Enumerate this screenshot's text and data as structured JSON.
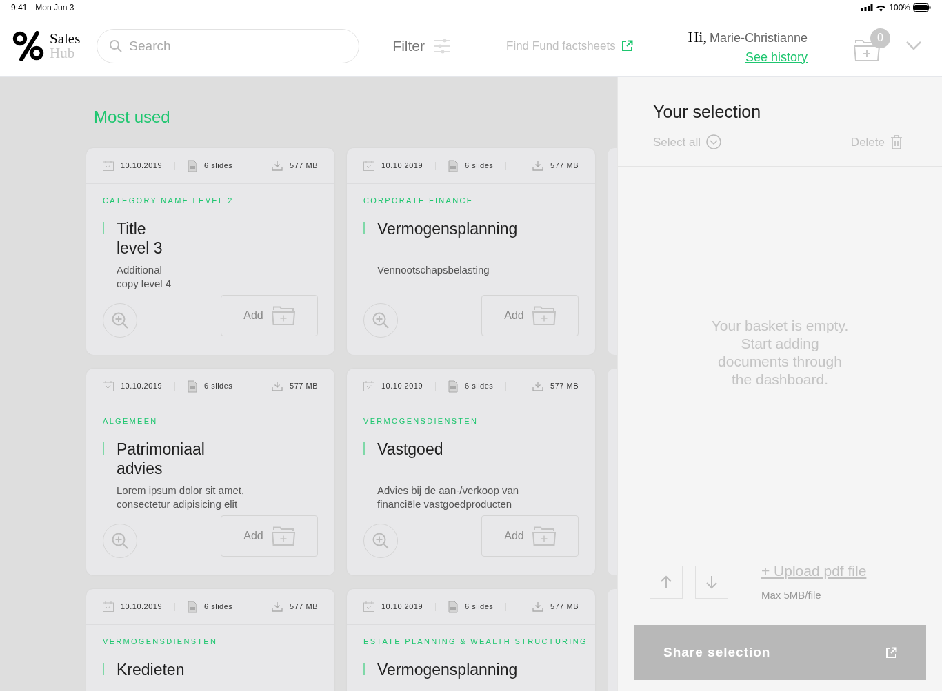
{
  "status_bar": {
    "time": "9:41",
    "date": "Mon Jun 3",
    "battery": "100%"
  },
  "header": {
    "logo_top": "Sales",
    "logo_bottom": "Hub",
    "search": {
      "placeholder": "Search"
    },
    "filter": "Filter",
    "factsheets_link": "Find Fund factsheets",
    "greeting": "Hi,",
    "user_name": "Marie-Christianne",
    "history_link": "See history",
    "basket_count": "0"
  },
  "section_title": "Most used",
  "cards": [
    {
      "date": "10.10.2019",
      "slides": "6 slides",
      "size": "577 MB",
      "category": "CATEGORY NAME LEVEL 2",
      "title": "Title\nlevel 3",
      "description": "Additional\ncopy level 4",
      "add_label": "Add"
    },
    {
      "date": "10.10.2019",
      "slides": "6 slides",
      "size": "577 MB",
      "category": "CORPORATE FINANCE",
      "title": "Vermogensplanning",
      "description": "Vennootschapsbelasting",
      "add_label": "Add"
    },
    {
      "date": "10.10.2019",
      "slides": "6 slides",
      "size": "577 MB",
      "category": "ALGEMEEN",
      "title": "Patrimoniaal\nadvies",
      "description": "Lorem ipsum dolor sit amet,\nconsectetur adipisicing elit",
      "add_label": "Add"
    },
    {
      "date": "10.10.2019",
      "slides": "6 slides",
      "size": "577 MB",
      "category": "VERMOGENSDIENSTEN",
      "title": "Vastgoed",
      "description": "Advies bij de aan-/verkoop van\nfinanciële vastgoedproducten",
      "add_label": "Add"
    },
    {
      "date": "10.10.2019",
      "slides": "6 slides",
      "size": "577 MB",
      "category": "VERMOGENSDIENSTEN",
      "title": "Kredieten"
    },
    {
      "date": "10.10.2019",
      "slides": "6 slides",
      "size": "577 MB",
      "category": "ESTATE PLANNING & WEALTH STRUCTURING",
      "title": "Vermogensplanning"
    }
  ],
  "selection": {
    "title": "Your selection",
    "select_all": "Select all",
    "delete": "Delete",
    "empty_message": "Your basket is empty.\nStart adding\ndocuments through\nthe dashboard.",
    "upload_link": "+ Upload pdf file",
    "upload_hint": "Max 5MB/file",
    "share_button": "Share selection"
  }
}
